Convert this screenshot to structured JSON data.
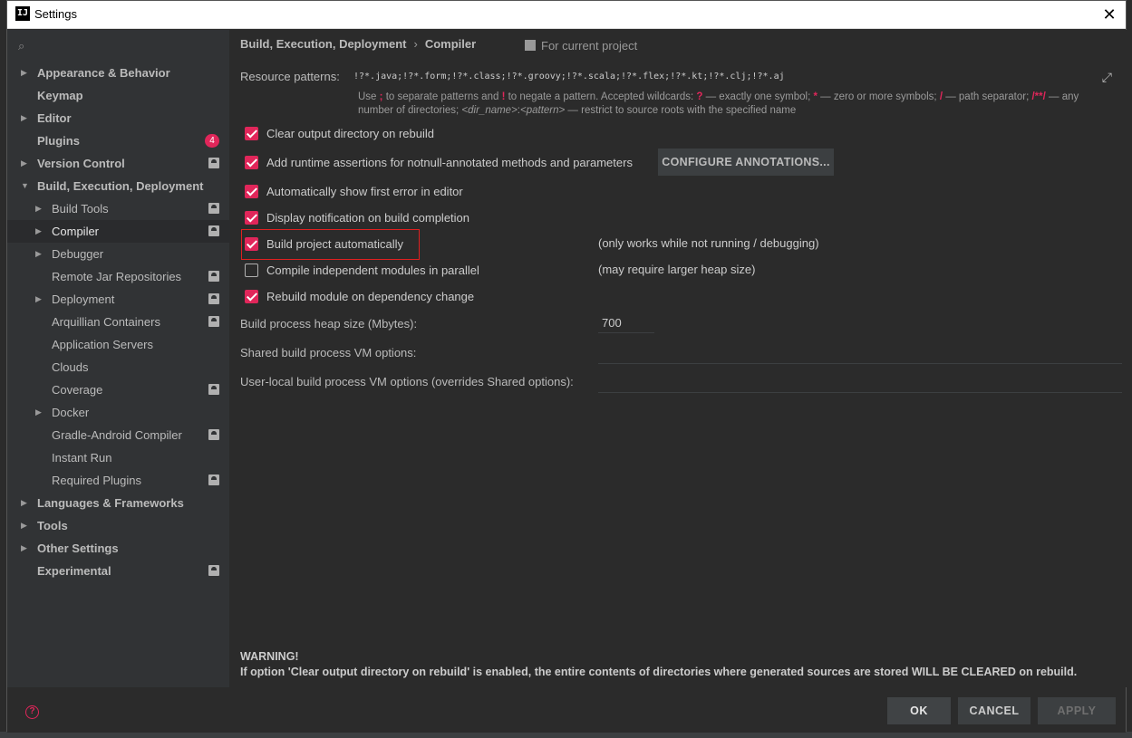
{
  "window": {
    "title": "Settings",
    "app_icon": "IJ"
  },
  "sidebar": {
    "search_placeholder": "",
    "items": [
      {
        "label": "Appearance & Behavior",
        "bold": true,
        "expand": "collapsed",
        "level": 0
      },
      {
        "label": "Keymap",
        "bold": true,
        "expand": "none",
        "level": 0
      },
      {
        "label": "Editor",
        "bold": true,
        "expand": "collapsed",
        "level": 0
      },
      {
        "label": "Plugins",
        "bold": true,
        "expand": "none",
        "level": 0,
        "badge": "4"
      },
      {
        "label": "Version Control",
        "bold": true,
        "expand": "collapsed",
        "level": 0,
        "project": true
      },
      {
        "label": "Build, Execution, Deployment",
        "bold": true,
        "expand": "expanded",
        "level": 0
      },
      {
        "label": "Build Tools",
        "expand": "collapsed",
        "level": 1,
        "project": true
      },
      {
        "label": "Compiler",
        "expand": "collapsed",
        "level": 1,
        "project": true,
        "selected": true
      },
      {
        "label": "Debugger",
        "expand": "collapsed",
        "level": 1
      },
      {
        "label": "Remote Jar Repositories",
        "expand": "none",
        "level": 1,
        "project": true
      },
      {
        "label": "Deployment",
        "expand": "collapsed",
        "level": 1,
        "project": true
      },
      {
        "label": "Arquillian Containers",
        "expand": "none",
        "level": 1,
        "project": true
      },
      {
        "label": "Application Servers",
        "expand": "none",
        "level": 1
      },
      {
        "label": "Clouds",
        "expand": "none",
        "level": 1
      },
      {
        "label": "Coverage",
        "expand": "none",
        "level": 1,
        "project": true
      },
      {
        "label": "Docker",
        "expand": "collapsed",
        "level": 1
      },
      {
        "label": "Gradle-Android Compiler",
        "expand": "none",
        "level": 1,
        "project": true
      },
      {
        "label": "Instant Run",
        "expand": "none",
        "level": 1
      },
      {
        "label": "Required Plugins",
        "expand": "none",
        "level": 1,
        "project": true
      },
      {
        "label": "Languages & Frameworks",
        "bold": true,
        "expand": "collapsed",
        "level": 0
      },
      {
        "label": "Tools",
        "bold": true,
        "expand": "collapsed",
        "level": 0
      },
      {
        "label": "Other Settings",
        "bold": true,
        "expand": "collapsed",
        "level": 0
      },
      {
        "label": "Experimental",
        "bold": true,
        "expand": "none",
        "level": 0,
        "project": true
      }
    ]
  },
  "breadcrumb": {
    "parent": "Build, Execution, Deployment",
    "sep": "›",
    "current": "Compiler",
    "scope": "For current project"
  },
  "resource": {
    "label": "Resource patterns:",
    "value": "!?*.java;!?*.form;!?*.class;!?*.groovy;!?*.scala;!?*.flex;!?*.kt;!?*.clj;!?*.aj",
    "hint_1a": "Use ",
    "hint_1b": ";",
    "hint_1c": " to separate patterns and ",
    "hint_1d": "!",
    "hint_1e": " to negate a pattern. Accepted wildcards: ",
    "hint_1f": "?",
    "hint_1g": " — exactly one symbol; ",
    "hint_1h": "*",
    "hint_1i": " — zero or more symbols; ",
    "hint_1j": "/",
    "hint_1k": " — path separator; ",
    "hint_1l": "/**/",
    "hint_1m": " — any",
    "hint_2a": "number of directories; ",
    "hint_2b": "<dir_name>",
    "hint_2c": ":",
    "hint_2d": "<pattern>",
    "hint_2e": " — restrict to source roots with the specified name"
  },
  "options": {
    "clear_output": "Clear output directory on rebuild",
    "runtime_assertions": "Add runtime assertions for notnull-annotated methods and parameters",
    "configure_annotations": "CONFIGURE ANNOTATIONS...",
    "show_first_error": "Automatically show first error in editor",
    "display_notification": "Display notification on build completion",
    "build_automatically": "Build project automatically",
    "build_automatically_note": "(only works while not running / debugging)",
    "compile_parallel": "Compile independent modules in parallel",
    "compile_parallel_note": "(may require larger heap size)",
    "rebuild_module": "Rebuild module on dependency change"
  },
  "checkbox_states": {
    "clear_output": true,
    "runtime_assertions": true,
    "show_first_error": true,
    "display_notification": true,
    "build_automatically": true,
    "compile_parallel": false,
    "rebuild_module": true
  },
  "fields": {
    "heap_label": "Build process heap size (Mbytes):",
    "heap_value": "700",
    "shared_vm_label": "Shared build process VM options:",
    "shared_vm_value": "",
    "user_vm_label": "User-local build process VM options (overrides Shared options):",
    "user_vm_value": ""
  },
  "warning": {
    "title": "WARNING!",
    "text": "If option 'Clear output directory on rebuild' is enabled, the entire contents of directories where generated sources are stored WILL BE CLEARED on rebuild."
  },
  "footer": {
    "ok": "OK",
    "cancel": "CANCEL",
    "apply": "APPLY",
    "help": "?"
  },
  "colors": {
    "accent": "#e0265a",
    "background": "#2b2b2b",
    "sidebar": "#313335",
    "text": "#bbbbbb",
    "highlight_box": "#e02020"
  }
}
